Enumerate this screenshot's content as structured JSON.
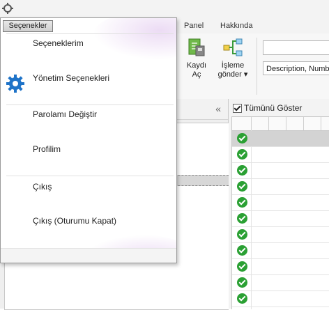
{
  "menu": {
    "button_label": "Seçenekler",
    "items": [
      {
        "label": "Seçeneklerim"
      },
      {
        "label": "Yönetim Seçenekleri",
        "icon": "gear-icon"
      },
      {
        "label": "Parolamı Değiştir"
      },
      {
        "label": "Profilim"
      },
      {
        "label": "Çıkış"
      },
      {
        "label": "Çıkış (Oturumu Kapat)"
      }
    ]
  },
  "tabs": [
    "Panel",
    "Hakkında"
  ],
  "ribbon": {
    "open_record": {
      "line1": "Kaydı",
      "line2": "Aç"
    },
    "send_process": {
      "line1": "İşleme",
      "line2": "gönder ▾"
    },
    "search_select": "Description, Numbe"
  },
  "right_pane": {
    "show_all_label": "Tümünü Göster"
  },
  "colors": {
    "accent_gear": "#1e73c8",
    "check_green": "#2aa033"
  }
}
